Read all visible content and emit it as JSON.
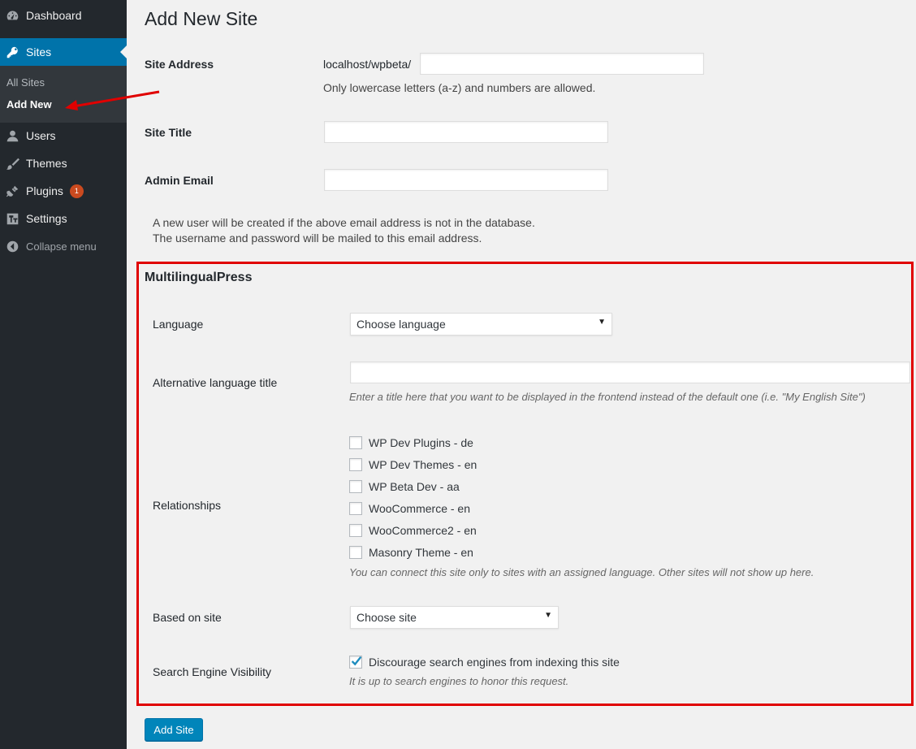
{
  "sidebar": {
    "items": [
      {
        "label": "Dashboard",
        "icon": "dashboard-icon"
      },
      {
        "label": "Sites",
        "icon": "key-icon"
      },
      {
        "label": "Users",
        "icon": "user-icon"
      },
      {
        "label": "Themes",
        "icon": "brush-icon"
      },
      {
        "label": "Plugins",
        "icon": "plugin-icon",
        "badge": "1"
      },
      {
        "label": "Settings",
        "icon": "settings-icon"
      }
    ],
    "submenu": [
      {
        "label": "All Sites"
      },
      {
        "label": "Add New"
      }
    ],
    "collapse_label": "Collapse menu"
  },
  "main": {
    "title": "Add New Site",
    "site_address": {
      "label": "Site Address",
      "prefix": "localhost/wpbeta/",
      "value": "",
      "hint": "Only lowercase letters (a-z) and numbers are allowed."
    },
    "site_title": {
      "label": "Site Title",
      "value": ""
    },
    "admin_email": {
      "label": "Admin Email",
      "value": ""
    },
    "note_line1": "A new user will be created if the above email address is not in the database.",
    "note_line2": "The username and password will be mailed to this email address."
  },
  "mlp": {
    "title": "MultilingualPress",
    "language": {
      "label": "Language",
      "selected": "Choose language"
    },
    "alt_title": {
      "label": "Alternative language title",
      "value": "",
      "hint": "Enter a title here that you want to be displayed in the frontend instead of the default one (i.e. \"My English Site\")"
    },
    "relationships": {
      "label": "Relationships",
      "options": [
        {
          "label": "WP Dev Plugins - de",
          "checked": false
        },
        {
          "label": "WP Dev Themes - en",
          "checked": false
        },
        {
          "label": "WP Beta Dev - aa",
          "checked": false
        },
        {
          "label": "WooCommerce - en",
          "checked": false
        },
        {
          "label": "WooCommerce2 - en",
          "checked": false
        },
        {
          "label": "Masonry Theme - en",
          "checked": false
        }
      ],
      "hint": "You can connect this site only to sites with an assigned language. Other sites will not show up here."
    },
    "based_on": {
      "label": "Based on site",
      "selected": "Choose site"
    },
    "visibility": {
      "label": "Search Engine Visibility",
      "checkbox_label": "Discourage search engines from indexing this site",
      "checked": true,
      "hint": "It is up to search engines to honor this request."
    }
  },
  "submit_label": "Add Site",
  "colors": {
    "sidebar_bg": "#23282d",
    "accent": "#0073aa",
    "annotation": "#e00000",
    "badge": "#ca4a1f"
  }
}
